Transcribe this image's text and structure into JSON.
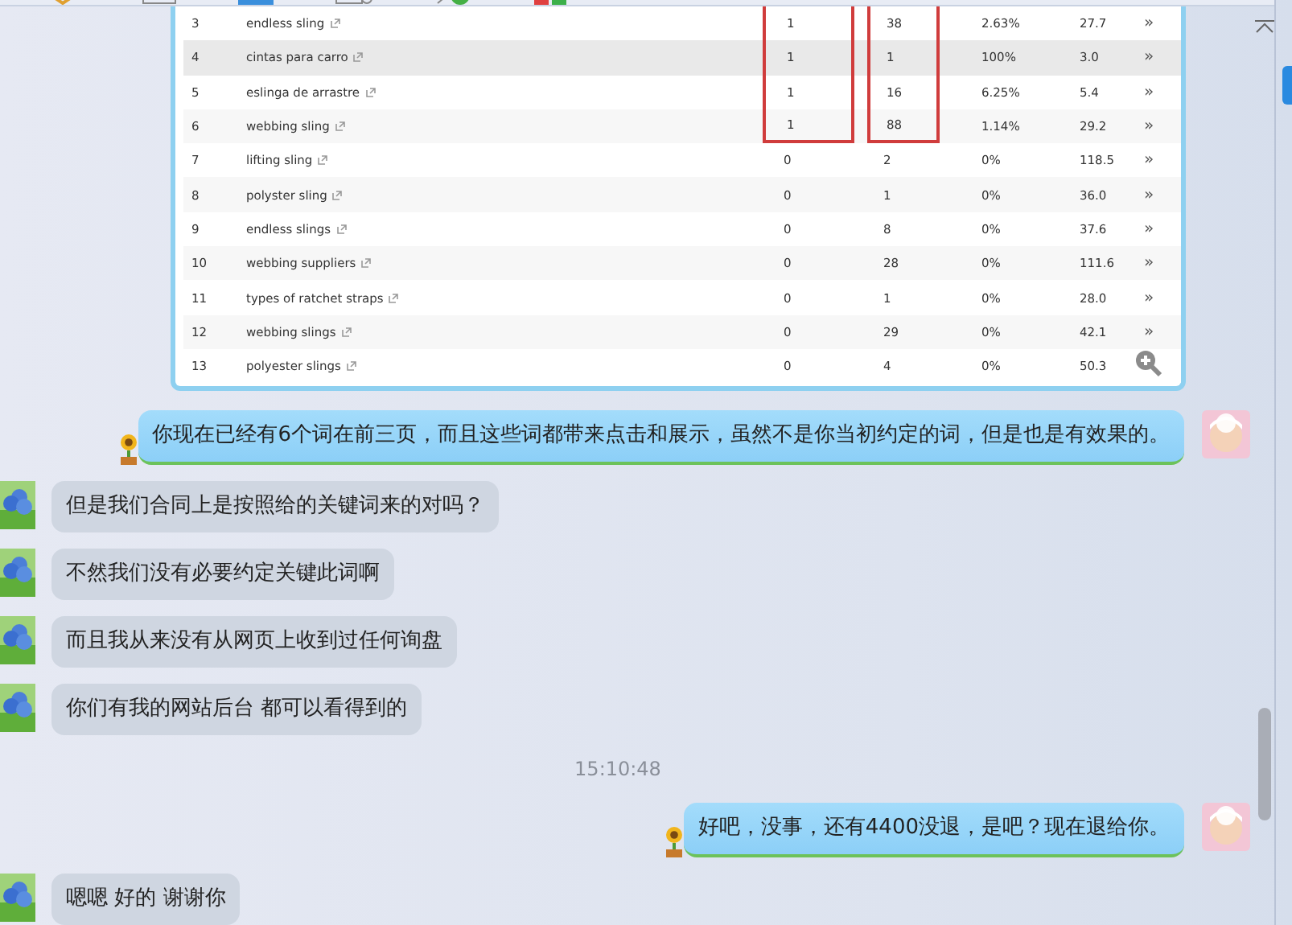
{
  "table": {
    "rows": [
      {
        "rank": "3",
        "keyword": "endless sling",
        "column_3": "1",
        "column_4": "38",
        "column_5": "2.63%",
        "column_6": "27.7",
        "highlighted": false,
        "marked": true
      },
      {
        "rank": "4",
        "keyword": "cintas para carro",
        "column_3": "1",
        "column_4": "1",
        "column_5": "100%",
        "column_6": "3.0",
        "highlighted": true,
        "marked": true
      },
      {
        "rank": "5",
        "keyword": "eslinga de arrastre",
        "column_3": "1",
        "column_4": "16",
        "column_5": "6.25%",
        "column_6": "5.4",
        "highlighted": false,
        "marked": true
      },
      {
        "rank": "6",
        "keyword": "webbing sling",
        "column_3": "1",
        "column_4": "88",
        "column_5": "1.14%",
        "column_6": "29.2",
        "highlighted": false,
        "marked": true
      },
      {
        "rank": "7",
        "keyword": "lifting sling",
        "column_3": "0",
        "column_4": "2",
        "column_5": "0%",
        "column_6": "118.5",
        "highlighted": false,
        "marked": false
      },
      {
        "rank": "8",
        "keyword": "polyster sling",
        "column_3": "0",
        "column_4": "1",
        "column_5": "0%",
        "column_6": "36.0",
        "highlighted": false,
        "marked": false
      },
      {
        "rank": "9",
        "keyword": "endless slings",
        "column_3": "0",
        "column_4": "8",
        "column_5": "0%",
        "column_6": "37.6",
        "highlighted": false,
        "marked": false
      },
      {
        "rank": "10",
        "keyword": "webbing suppliers",
        "column_3": "0",
        "column_4": "28",
        "column_5": "0%",
        "column_6": "111.6",
        "highlighted": false,
        "marked": false
      },
      {
        "rank": "11",
        "keyword": "types of ratchet straps",
        "column_3": "0",
        "column_4": "1",
        "column_5": "0%",
        "column_6": "28.0",
        "highlighted": false,
        "marked": false
      },
      {
        "rank": "12",
        "keyword": "webbing slings",
        "column_3": "0",
        "column_4": "29",
        "column_5": "0%",
        "column_6": "42.1",
        "highlighted": false,
        "marked": false
      },
      {
        "rank": "13",
        "keyword": "polyester slings",
        "column_3": "0",
        "column_4": "4",
        "column_5": "0%",
        "column_6": "50.3",
        "highlighted": false,
        "marked": false
      }
    ],
    "row_action": "»"
  },
  "messages": [
    {
      "kind": "message",
      "outgoing": true,
      "text": "你现在已经有6个词在前三页，而且这些词都带来点击和展示，虽然不是你当初约定的词，但是也是有效果的。"
    },
    {
      "kind": "message",
      "outgoing": false,
      "text": "但是我们合同上是按照给的关键词来的对吗？"
    },
    {
      "kind": "message",
      "outgoing": false,
      "text": "不然我们没有必要约定关键此词啊"
    },
    {
      "kind": "message",
      "outgoing": false,
      "text": "而且我从来没有从网页上收到过任何询盘"
    },
    {
      "kind": "message",
      "outgoing": false,
      "text": "你们有我的网站后台 都可以看得到的"
    },
    {
      "kind": "time",
      "text": "15:10:48"
    },
    {
      "kind": "message",
      "outgoing": true,
      "text": "好吧，没事，还有4400没退，是吧？现在退给你。"
    },
    {
      "kind": "message",
      "outgoing": false,
      "text": "嗯嗯 好的 谢谢你"
    }
  ]
}
